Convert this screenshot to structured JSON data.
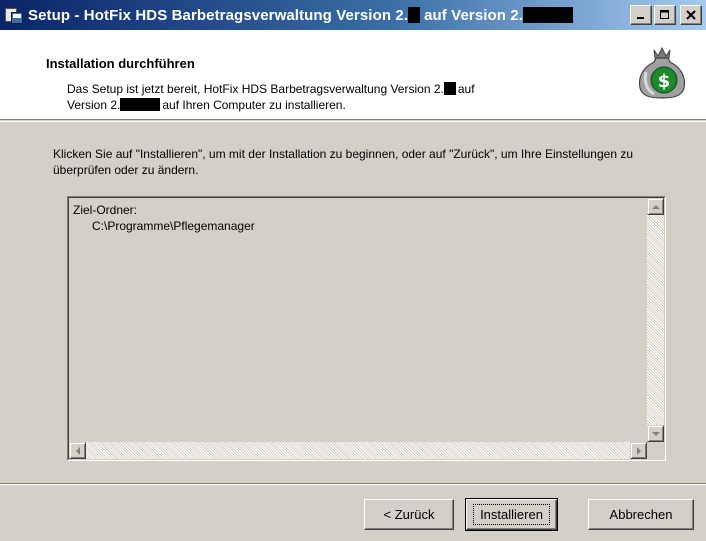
{
  "window": {
    "title_prefix": "Setup - HotFix HDS Barbetragsverwaltung Version 2.",
    "title_middle": "auf Version 2.",
    "minimize_label": "_",
    "maximize_label": "□",
    "close_label": "×"
  },
  "header": {
    "title": "Installation durchführen",
    "desc_line1_prefix": "Das Setup ist jetzt bereit, HotFix HDS Barbetragsverwaltung Version 2.",
    "desc_line1_suffix": "auf",
    "desc_line2_prefix": "Version 2.",
    "desc_line2_suffix": "auf Ihren Computer zu installieren.",
    "icon": "money-bag-icon"
  },
  "main": {
    "intro": "Klicken Sie auf \"Installieren\", um mit der Installation zu beginnen, oder auf \"Zurück\", um Ihre Einstellungen zu überprüfen oder zu ändern.",
    "memo_line1": "Ziel-Ordner:",
    "memo_line2": "C:\\Programme\\Pflegemanager"
  },
  "buttons": {
    "back": "< Zurück",
    "install": "Installieren",
    "cancel": "Abbrechen"
  },
  "colors": {
    "titlebar_start": "#0a246a",
    "titlebar_end": "#a6caf0",
    "dialog_bg": "#d4d0c8",
    "money_bag": "#9a9a9a",
    "dollar_circle": "#1e8a2e"
  }
}
